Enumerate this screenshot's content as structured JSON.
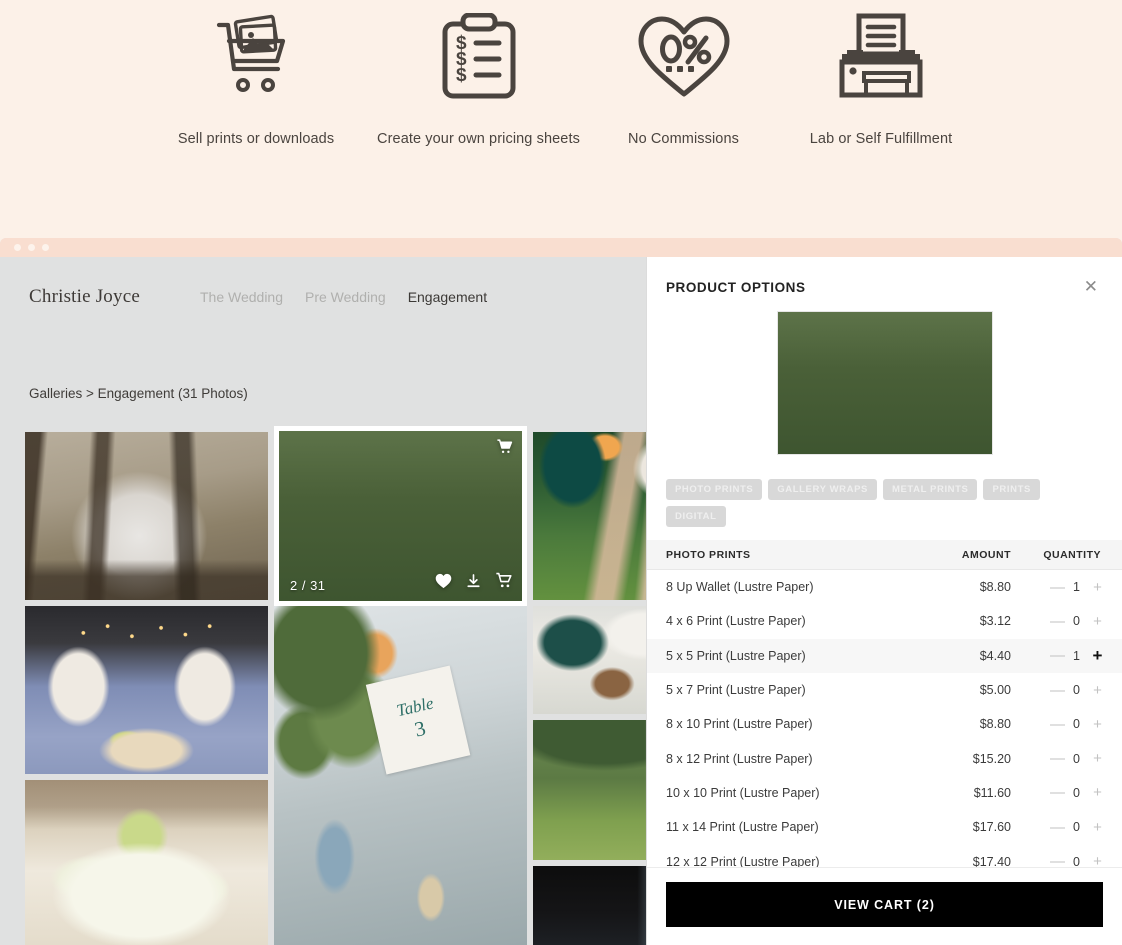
{
  "features": [
    {
      "icon": "cart-with-photo-icon",
      "label": "Sell prints or downloads"
    },
    {
      "icon": "clipboard-pricing-icon",
      "label": "Create your own pricing sheets"
    },
    {
      "icon": "heart-zero-percent-icon",
      "label": "No Commissions"
    },
    {
      "icon": "printer-icon",
      "label": "Lab or Self Fulfillment"
    }
  ],
  "browser": {
    "dots": 3
  },
  "site": {
    "brand": "Christie Joyce",
    "nav": [
      {
        "label": "The Wedding",
        "active": false
      },
      {
        "label": "Pre Wedding",
        "active": false
      },
      {
        "label": "Engagement",
        "active": true
      }
    ],
    "breadcrumb": "Galleries > Engagement (31 Photos)"
  },
  "gallery": {
    "selected_badge": "2 / 31",
    "tile_icons": {
      "cart_top": "cart-icon",
      "favorite": "heart-icon",
      "download": "download-icon",
      "cart": "cart-icon"
    },
    "table_card": {
      "line1": "Table",
      "line2": "3"
    }
  },
  "panel": {
    "title": "PRODUCT OPTIONS",
    "close_label": "✕",
    "hero_alt": "bride-and-bridesmaid-photo",
    "chips": [
      "PHOTO PRINTS",
      "GALLERY WRAPS",
      "METAL PRINTS",
      "PRINTS",
      "DIGITAL"
    ],
    "columns": {
      "name": "PHOTO PRINTS",
      "amount": "AMOUNT",
      "quantity": "QUANTITY"
    },
    "products": [
      {
        "name": "8 Up Wallet (Lustre Paper)",
        "amount": "$8.80",
        "qty": "1",
        "highlight": false,
        "plus_strong": false
      },
      {
        "name": "4 x 6 Print (Lustre Paper)",
        "amount": "$3.12",
        "qty": "0",
        "highlight": false,
        "plus_strong": false
      },
      {
        "name": "5 x 5 Print (Lustre Paper)",
        "amount": "$4.40",
        "qty": "1",
        "highlight": true,
        "plus_strong": true
      },
      {
        "name": "5 x 7 Print (Lustre Paper)",
        "amount": "$5.00",
        "qty": "0",
        "highlight": false,
        "plus_strong": false
      },
      {
        "name": "8 x 10 Print (Lustre Paper)",
        "amount": "$8.80",
        "qty": "0",
        "highlight": false,
        "plus_strong": false
      },
      {
        "name": "8 x 12 Print (Lustre Paper)",
        "amount": "$15.20",
        "qty": "0",
        "highlight": false,
        "plus_strong": false
      },
      {
        "name": "10 x 10 Print (Lustre Paper)",
        "amount": "$11.60",
        "qty": "0",
        "highlight": false,
        "plus_strong": false
      },
      {
        "name": "11 x 14 Print (Lustre Paper)",
        "amount": "$17.60",
        "qty": "0",
        "highlight": false,
        "plus_strong": false
      },
      {
        "name": "12 x 12 Print (Lustre Paper)",
        "amount": "$17.40",
        "qty": "0",
        "highlight": false,
        "plus_strong": false
      }
    ],
    "minus_label": "—",
    "plus_label": "+",
    "cart_button": "VIEW CART (2)"
  },
  "colors": {
    "page_background": "#fcf1e8",
    "browser_chrome": "#f9ded0",
    "site_background": "#e0e1e1",
    "panel_background": "#ffffff",
    "chip_background": "#d8d8d8",
    "cart_button_background": "#000000",
    "text_primary": "#3b3b3b",
    "text_muted": "#b0b0ae"
  }
}
